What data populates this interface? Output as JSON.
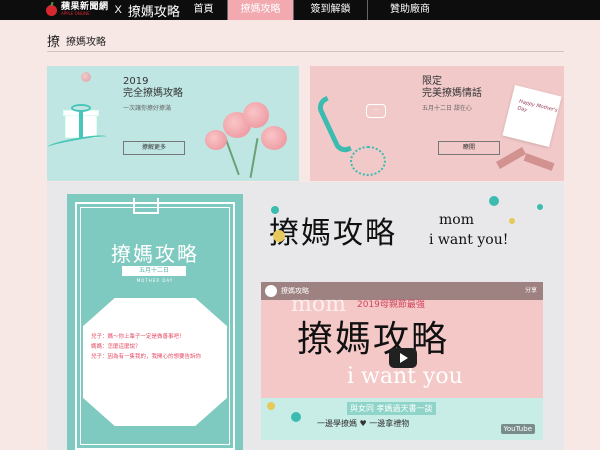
{
  "brand": {
    "name": "蘋果新聞網",
    "sub": "APPLE ONLINE",
    "x": "X",
    "title": "撩媽攻略"
  },
  "nav": {
    "items": [
      {
        "label": "首頁"
      },
      {
        "label": "撩媽攻略"
      },
      {
        "label": "簽到解鎖"
      },
      {
        "label": "贊助廠商"
      }
    ],
    "active_index": 1,
    "active_color": "#f2a9b0"
  },
  "section": {
    "glyph": "撩",
    "title": "撩媽攻略"
  },
  "banner_left": {
    "year": "2019",
    "title": "完全撩媽攻略",
    "subtitle": "一次讓你撩好撩滿",
    "button": "撩解更多"
  },
  "banner_right": {
    "line1": "限定",
    "line2": "完美撩媽情話",
    "subtitle": "五月十二日 甜在心",
    "button": "瞭開",
    "card_note": "Happy Mother's Day"
  },
  "poster": {
    "title": "撩媽攻略",
    "date": "五月十二日",
    "day": "MOTHER DAY",
    "dialog": [
      "兒子：媽～你上輩子一定是做善事吧！",
      "媽媽：怎麼這麼說？",
      "兒子：因為有一隻我的，我開心的想要告訴你"
    ]
  },
  "headline": {
    "big": "撩媽攻略",
    "line1": "mom",
    "line2": "i want you!"
  },
  "video": {
    "channel": "撩媽攻略",
    "share": "分享",
    "year_title": "2019母親節最強",
    "bg_mom": "mom",
    "title": "撩媽攻略",
    "iwant": "i want you",
    "tag": "與女同 孝媽過天書一談",
    "tag2": "一邊學撩媽 ♥ 一邊拿禮物",
    "yt": "YouTube"
  },
  "colors": {
    "teal": "#7fcac0",
    "pink": "#f2c9c9",
    "accent": "#f2a9b0"
  }
}
